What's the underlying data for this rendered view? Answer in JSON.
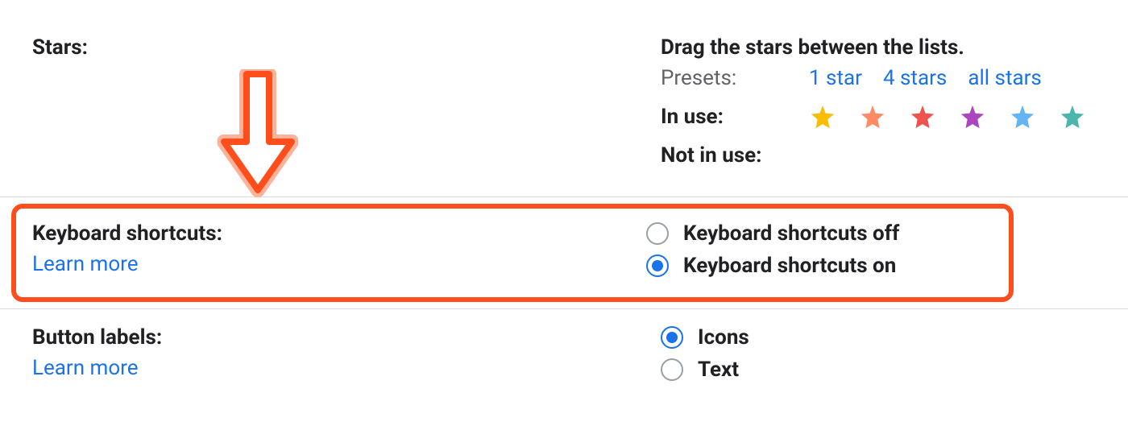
{
  "stars": {
    "label": "Stars:",
    "instruction": "Drag the stars between the lists.",
    "presets_label": "Presets:",
    "presets": {
      "one": "1 star",
      "four": "4 stars",
      "all": "all stars"
    },
    "in_use_label": "In use:",
    "not_in_use_label": "Not in use:",
    "in_use": [
      {
        "name": "star-yellow",
        "color": "#fbbc04"
      },
      {
        "name": "star-orange",
        "color": "#ff8a65"
      },
      {
        "name": "star-red",
        "color": "#ef5350"
      },
      {
        "name": "star-purple",
        "color": "#ab47bc"
      },
      {
        "name": "star-blue",
        "color": "#64b5f6"
      },
      {
        "name": "star-green",
        "color": "#4db6ac"
      }
    ]
  },
  "keyboard_shortcuts": {
    "label": "Keyboard shortcuts:",
    "learn_more": "Learn more",
    "off_label": "Keyboard shortcuts off",
    "on_label": "Keyboard shortcuts on",
    "selected": "on"
  },
  "button_labels": {
    "label": "Button labels:",
    "learn_more": "Learn more",
    "icons_label": "Icons",
    "text_label": "Text",
    "selected": "icons"
  }
}
